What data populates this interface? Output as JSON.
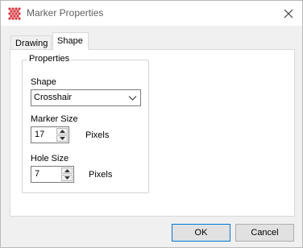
{
  "window": {
    "title": "Marker Properties",
    "icon": "grid-dots-app-icon",
    "accent_color": "#d8343f"
  },
  "tabs": [
    {
      "label": "Drawing",
      "active": false
    },
    {
      "label": "Shape",
      "active": true
    }
  ],
  "properties": {
    "group_label": "Properties",
    "shape_label": "Shape",
    "shape_value": "Crosshair",
    "marker_size_label": "Marker Size",
    "marker_size_value": "17",
    "marker_size_unit": "Pixels",
    "hole_size_label": "Hole Size",
    "hole_size_value": "7",
    "hole_size_unit": "Pixels"
  },
  "buttons": {
    "ok": "OK",
    "cancel": "Cancel"
  }
}
